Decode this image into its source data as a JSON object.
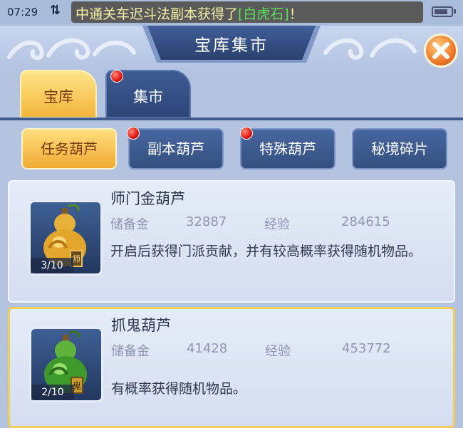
{
  "status": {
    "time": "07:29",
    "notice_prefix": "中通关车迟斗法副本获得了",
    "notice_item": "[白虎石]",
    "notice_suffix": "！"
  },
  "header": {
    "title": "宝库集市"
  },
  "tabs": [
    {
      "label": "宝库",
      "selected": true
    },
    {
      "label": "集市",
      "selected": false,
      "red_dot": true
    }
  ],
  "categories": [
    {
      "label": "任务葫芦",
      "selected": true
    },
    {
      "label": "副本葫芦",
      "selected": false,
      "red_dot": true
    },
    {
      "label": "特殊葫芦",
      "selected": false,
      "red_dot": true
    },
    {
      "label": "秘境碎片",
      "selected": false
    }
  ],
  "items": [
    {
      "name": "师门金葫芦",
      "count": "3/10",
      "reserve_label": "储备金",
      "reserve_value": "32887",
      "exp_label": "经验",
      "exp_value": "284615",
      "description": "开启后获得门派贡献，并有较高概率获得随机物品。",
      "icon": "gold-gourd-icon",
      "tag_char": "师",
      "selected": false
    },
    {
      "name": "抓鬼葫芦",
      "count": "2/10",
      "reserve_label": "储备金",
      "reserve_value": "41428",
      "exp_label": "经验",
      "exp_value": "453772",
      "description": "有概率获得随机物品。",
      "icon": "green-gourd-icon",
      "tag_char": "鬼",
      "selected": true
    }
  ],
  "colors": {
    "background": "#b3c3e0",
    "tab_active": "#f2b53a",
    "tab_inactive": "#2c4678",
    "close_button": "#f0792a",
    "selected_border": "#f0ce5a",
    "notice_text": "#f3f0a5",
    "notice_highlight": "#58e05a"
  }
}
